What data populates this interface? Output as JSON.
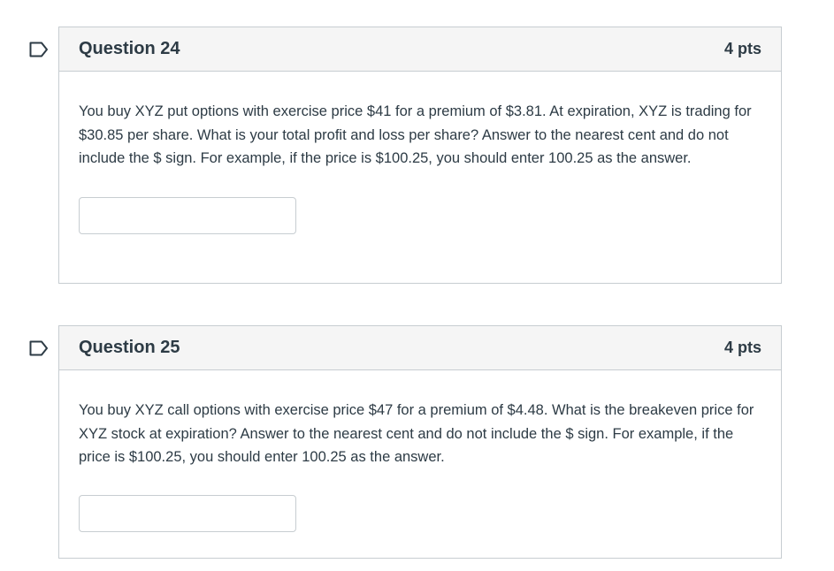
{
  "questions": [
    {
      "title": "Question 24",
      "points": "4 pts",
      "text": "You buy XYZ put options with exercise price $41 for a premium of $3.81. At expiration, XYZ is trading for $30.85 per share. What is your total profit and loss per share? Answer to the nearest cent and do not include the $ sign. For example, if the price is $100.25, you should enter 100.25 as the answer.",
      "answer_value": "",
      "flag_icon": "flag-question-icon"
    },
    {
      "title": "Question 25",
      "points": "4 pts",
      "text": "You buy XYZ call options with exercise price $47 for a premium of $4.48. What is the breakeven price for XYZ stock at expiration? Answer to the nearest cent and do not include the $ sign. For example, if the price is $100.25, you should enter 100.25 as the answer.",
      "answer_value": "",
      "flag_icon": "flag-question-icon"
    }
  ],
  "colors": {
    "border": "#c7cdd1",
    "header_bg": "#f5f5f5",
    "text": "#2d3b45",
    "flag": "#2d3b45"
  }
}
